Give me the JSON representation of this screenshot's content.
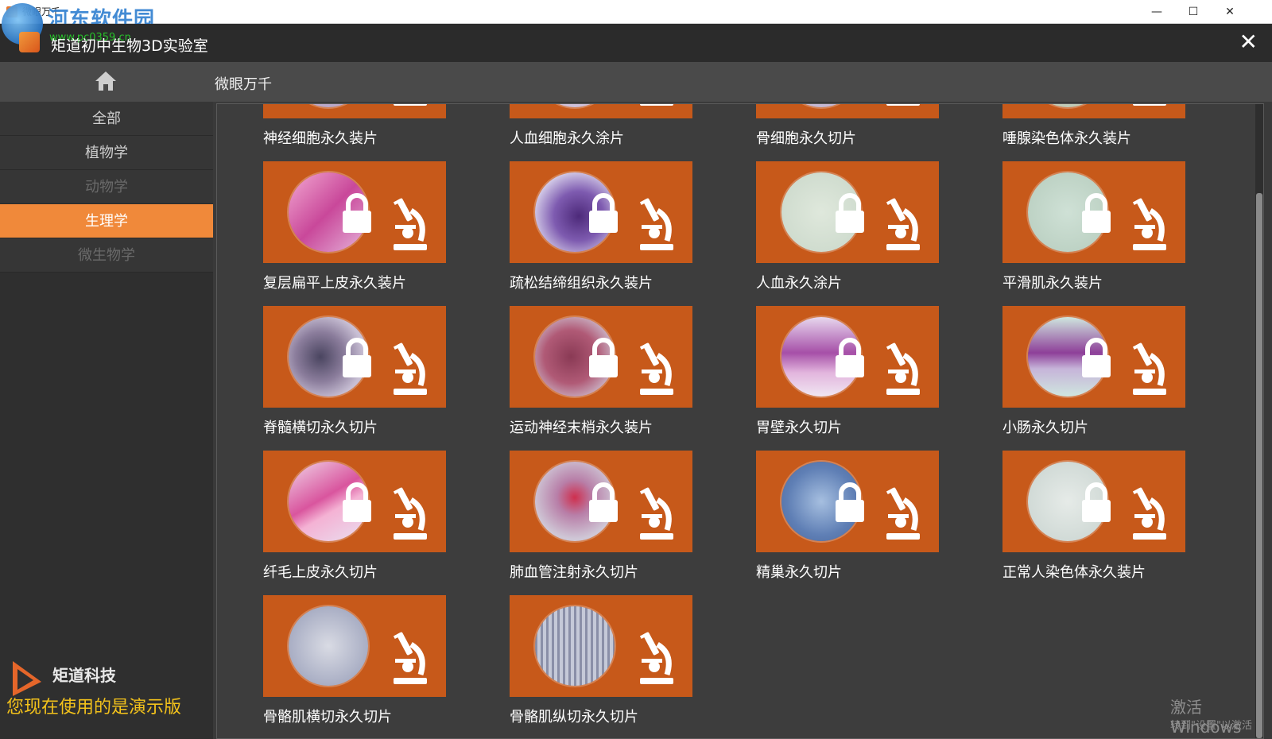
{
  "window": {
    "title": "微眼万千",
    "watermark": "河东软件园",
    "watermark_url": "www.pc0359.cn",
    "controls": {
      "minimize": "—",
      "maximize": "☐",
      "close": "✕"
    }
  },
  "app": {
    "title": "矩道初中生物3D实验室",
    "close": "✕"
  },
  "subheader": {
    "title": "微眼万千"
  },
  "sidebar": {
    "categories": [
      {
        "label": "全部",
        "state": "normal"
      },
      {
        "label": "植物学",
        "state": "normal"
      },
      {
        "label": "动物学",
        "state": "dim"
      },
      {
        "label": "生理学",
        "state": "active"
      },
      {
        "label": "微生物学",
        "state": "dim"
      }
    ],
    "brand": "矩道科技",
    "demo_note": "您现在使用的是演示版"
  },
  "colors": {
    "accent": "#f0893a",
    "card": "#c7591a",
    "demo": "#f3c21b"
  },
  "slides": [
    {
      "label": "神经细胞永久装片",
      "locked": true,
      "circle": "linear-gradient(#d7c9d9,#b9a7c7)"
    },
    {
      "label": "人血细胞永久涂片",
      "locked": true,
      "circle": "linear-gradient(#e3d7df,#cdbfd8)"
    },
    {
      "label": "骨细胞永久切片",
      "locked": true,
      "circle": "linear-gradient(#dcd3e3,#c4b7d1)"
    },
    {
      "label": "唾腺染色体永久装片",
      "locked": true,
      "circle": "linear-gradient(#d9dfcf,#c0c9b6)"
    },
    {
      "label": "复层扁平上皮永久装片",
      "locked": true,
      "circle": "linear-gradient(135deg,#f3a9d2,#c9489a 50%,#e6b7dc)"
    },
    {
      "label": "疏松结缔组织永久装片",
      "locked": true,
      "circle": "radial-gradient(circle at 55% 55%,#4d2a7a,#7e5bb0 40%,#d7d0ea 75%)"
    },
    {
      "label": "人血永久涂片",
      "locked": true,
      "circle": "radial-gradient(circle,#dfe8dc,#c9d7c9)"
    },
    {
      "label": "平滑肌永久装片",
      "locked": true,
      "circle": "radial-gradient(circle,#cfe1d6,#b6ccbd)"
    },
    {
      "label": "脊髓横切永久切片",
      "locked": true,
      "circle": "radial-gradient(circle at 40% 50%,#4a4560,#8b7d9c 40%,#c8bfd4 70%)"
    },
    {
      "label": "运动神经末梢永久装片",
      "locked": true,
      "circle": "radial-gradient(circle at 45% 50%,#8a3a55,#b05a76 45%,#cab2c4 75%)"
    },
    {
      "label": "胃壁永久切片",
      "locked": true,
      "circle": "linear-gradient(180deg,#e7d7ee,#a64fa8 45%,#e2b5dd 70%,#f0e6f2)"
    },
    {
      "label": "小肠永久切片",
      "locked": true,
      "circle": "linear-gradient(180deg,#cfe6df,#8e3f99 45%,#c6b4d9 65%,#cfe6df)"
    },
    {
      "label": "纤毛上皮永久切片",
      "locked": true,
      "circle": "linear-gradient(150deg,#f0d5e8,#d9559e 45%,#f4b2d4 60%,#e9e0f0)"
    },
    {
      "label": "肺血管注射永久切片",
      "locked": true,
      "circle": "radial-gradient(circle at 50% 45%,#cf2f4e,#b87fa8 30%,#cfc7d6 70%)"
    },
    {
      "label": "精巢永久切片",
      "locked": true,
      "circle": "radial-gradient(circle,#a6bfe0,#5f7fb5 60%,#4b679c)"
    },
    {
      "label": "正常人染色体永久装片",
      "locked": true,
      "circle": "radial-gradient(circle,#e6ebe8,#c8d3cf)"
    },
    {
      "label": "骨骼肌横切永久切片",
      "locked": false,
      "circle": "radial-gradient(circle,#d9dbe4,#a9aec4 70%)"
    },
    {
      "label": "骨骼肌纵切永久切片",
      "locked": false,
      "circle": "repeating-linear-gradient(90deg,#8a8fa8 0 3px,#c5c9d8 3px 7px)"
    }
  ],
  "activation": {
    "line1": "激活 Windows",
    "line2": "转到\"设置\"以激活"
  }
}
